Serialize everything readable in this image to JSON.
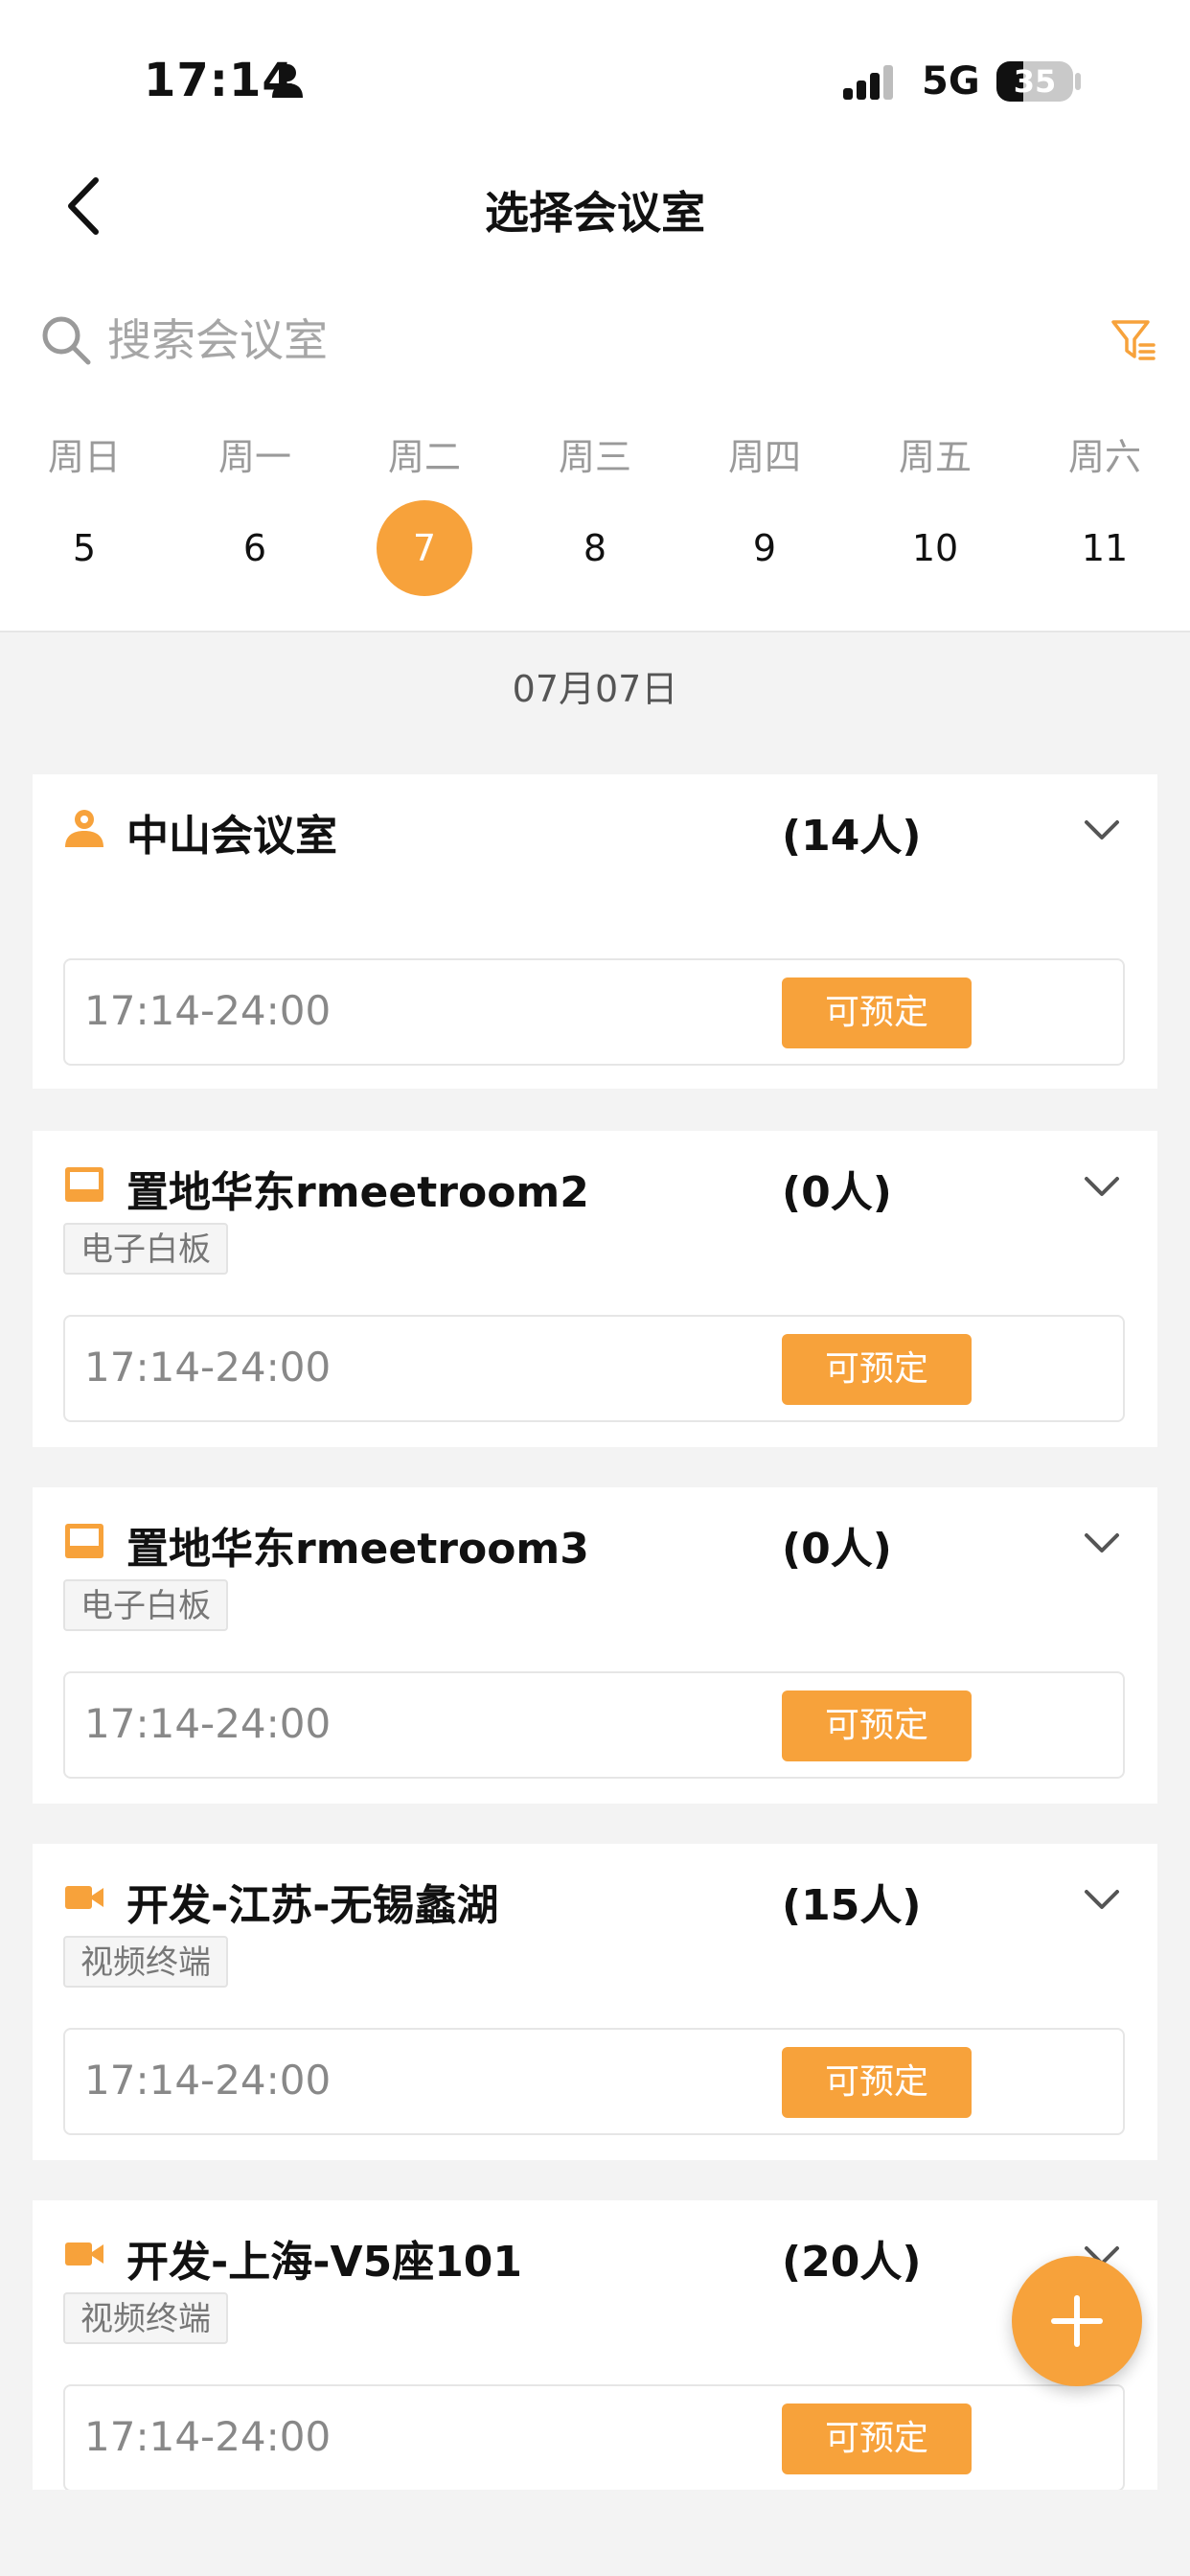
{
  "status_bar": {
    "time": "17:14",
    "network": "5G",
    "battery": "35",
    "battery_level": 0.35
  },
  "nav": {
    "title": "选择会议室",
    "back_icon": "chevron-left-icon"
  },
  "search": {
    "placeholder": "搜索会议室",
    "value": ""
  },
  "week": {
    "weekdays": [
      "周日",
      "周一",
      "周二",
      "周三",
      "周四",
      "周五",
      "周六"
    ],
    "days": [
      "5",
      "6",
      "7",
      "8",
      "9",
      "10",
      "11"
    ],
    "selected_index": 2
  },
  "date_label": "07月07日",
  "colors": {
    "accent": "#f7a23b",
    "background": "#f3f3f3"
  },
  "rooms": [
    {
      "name": "中山会议室",
      "capacity": "(14人)",
      "icon": "person-icon",
      "tag": "",
      "slot_time": "17:14-24:00",
      "book_label": "可预定"
    },
    {
      "name": "置地华东rmeetroom2",
      "capacity": "(0人)",
      "icon": "whiteboard-icon",
      "tag": "电子白板",
      "slot_time": "17:14-24:00",
      "book_label": "可预定"
    },
    {
      "name": "置地华东rmeetroom3",
      "capacity": "(0人)",
      "icon": "whiteboard-icon",
      "tag": "电子白板",
      "slot_time": "17:14-24:00",
      "book_label": "可预定"
    },
    {
      "name": "开发-江苏-无锡蠡湖",
      "capacity": "(15人)",
      "icon": "video-camera-icon",
      "tag": "视频终端",
      "slot_time": "17:14-24:00",
      "book_label": "可预定"
    },
    {
      "name": "开发-上海-V5座101",
      "capacity": "(20人)",
      "icon": "video-camera-icon",
      "tag": "视频终端",
      "slot_time": "17:14-24:00",
      "book_label": "可预定"
    }
  ],
  "fab_icon": "plus-icon"
}
